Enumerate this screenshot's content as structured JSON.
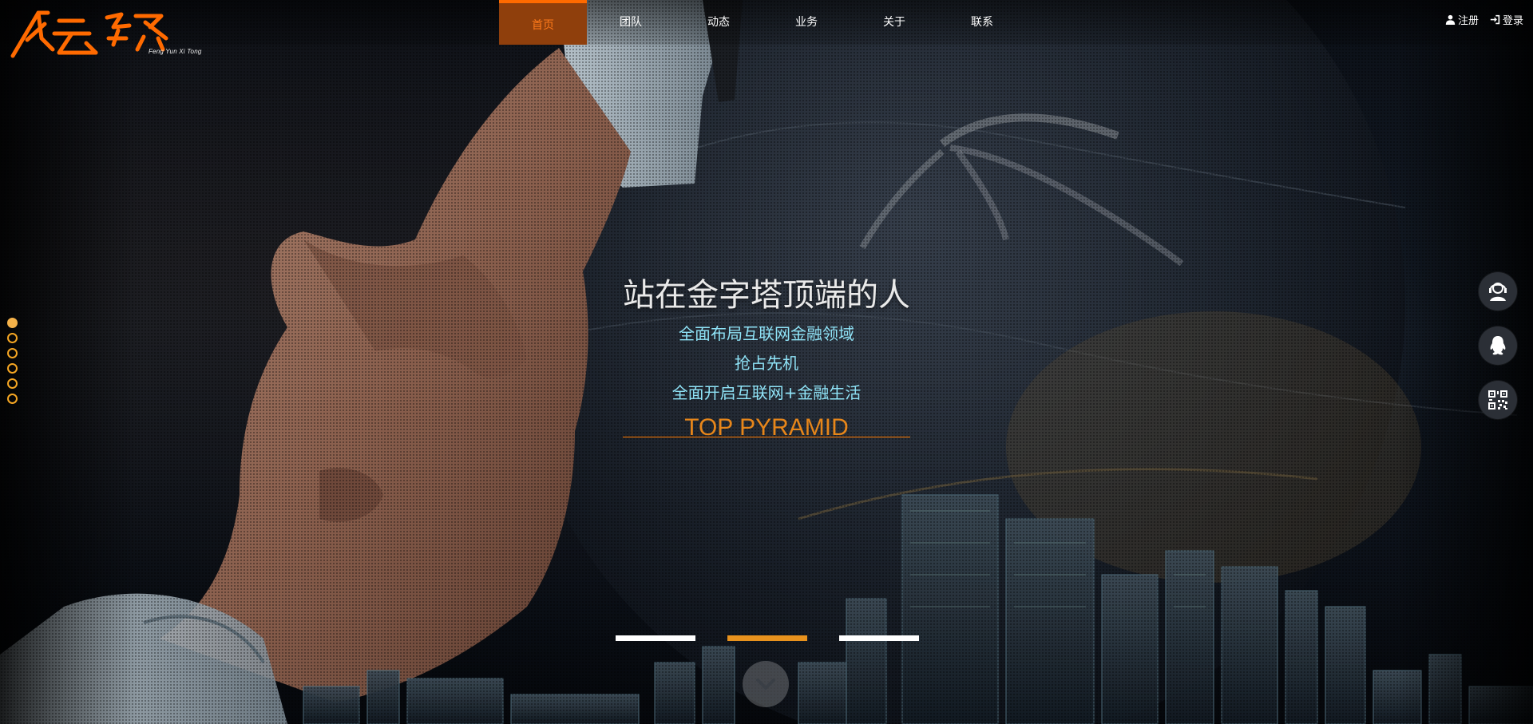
{
  "brand": {
    "name": "风云系统",
    "subtitle": "Feng Yun Xi Tong",
    "color": "#ff6a00"
  },
  "nav": {
    "items": [
      {
        "label": "首页",
        "active": true
      },
      {
        "label": "团队",
        "active": false
      },
      {
        "label": "动态",
        "active": false
      },
      {
        "label": "业务",
        "active": false
      },
      {
        "label": "关于",
        "active": false
      },
      {
        "label": "联系",
        "active": false
      }
    ]
  },
  "auth": {
    "register_label": "注册",
    "login_label": "登录",
    "register_icon": "user-icon",
    "login_icon": "sign-in-icon"
  },
  "hero": {
    "headline": "站在金字塔顶端的人",
    "lines": [
      "全面布局互联网金融领域",
      "抢占先机",
      "全面开启互联网+金融生活"
    ],
    "tagline": "TOP PYRAMID",
    "slides": [
      {
        "active": false
      },
      {
        "active": true
      },
      {
        "active": false
      }
    ],
    "scroll_icon": "chevron-down-icon"
  },
  "pager": {
    "dots": [
      {
        "active": true
      },
      {
        "active": false
      },
      {
        "active": false
      },
      {
        "active": false
      },
      {
        "active": false
      },
      {
        "active": false
      }
    ]
  },
  "float_buttons": [
    {
      "icon": "customer-service-icon"
    },
    {
      "icon": "qq-icon"
    },
    {
      "icon": "qr-code-icon"
    }
  ],
  "colors": {
    "accent": "#ff6a00",
    "active_nav_bg": "#8f3f0c",
    "subtext": "#8fe3f7",
    "tagline": "#e7861a",
    "pager_active": "#f5b24a"
  }
}
